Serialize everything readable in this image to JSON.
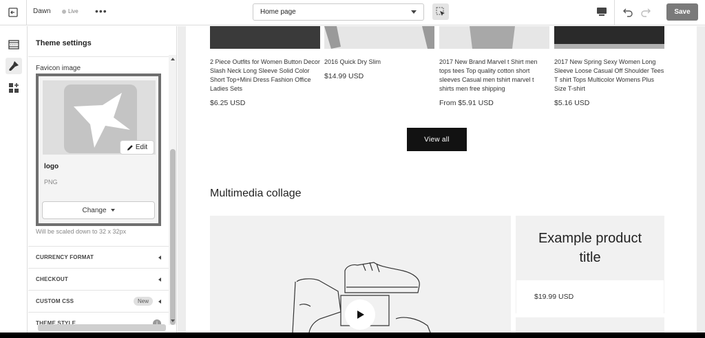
{
  "topbar": {
    "theme_name": "Dawn",
    "live_label": "Live",
    "more_label": "•••",
    "page_select_value": "Home page",
    "save_label": "Save"
  },
  "rail": {
    "items": [
      {
        "icon": "sections-icon",
        "active": false
      },
      {
        "icon": "theme-settings-icon",
        "active": true
      },
      {
        "icon": "app-embeds-icon",
        "active": false
      }
    ]
  },
  "panel": {
    "title": "Theme settings",
    "favicon_label": "Favicon image",
    "edit_label": "Edit",
    "file_name": "logo",
    "file_type": "PNG",
    "change_label": "Change",
    "scale_hint": "Will be scaled down to 32 x 32px",
    "accordion": [
      {
        "label": "CURRENCY FORMAT",
        "badge": ""
      },
      {
        "label": "CHECKOUT",
        "badge": ""
      },
      {
        "label": "CUSTOM CSS",
        "badge": "New"
      },
      {
        "label": "THEME STYLE",
        "badge": "i"
      }
    ]
  },
  "preview": {
    "products": [
      {
        "title": "2 Piece Outfits for Women Button Decor Slash Neck Long Sleeve Solid Color Short Top+Mini Dress Fashion Office Ladies Sets",
        "price": "$6.25 USD"
      },
      {
        "title": "2016 Quick Dry Slim",
        "price": "$14.99 USD"
      },
      {
        "title": "2017 New Brand Marvel t Shirt men tops tees Top quality cotton short sleeves Casual men tshirt marvel t shirts men free shipping",
        "price": "From $5.91 USD"
      },
      {
        "title": "2017 New Spring Sexy Women Long Sleeve Loose Casual Off Shoulder Tees T shirt Tops Multicolor Womens Plus Size T-shirt",
        "price": "$5.16 USD"
      }
    ],
    "view_all_label": "View all",
    "collage_title": "Multimedia collage",
    "collage_product_title": "Example product title",
    "collage_product_price": "$19.99 USD"
  },
  "colors": {
    "primary_button": "#121212",
    "save_button": "#7a7a7a",
    "focus_outline": "#6f6f6f"
  }
}
